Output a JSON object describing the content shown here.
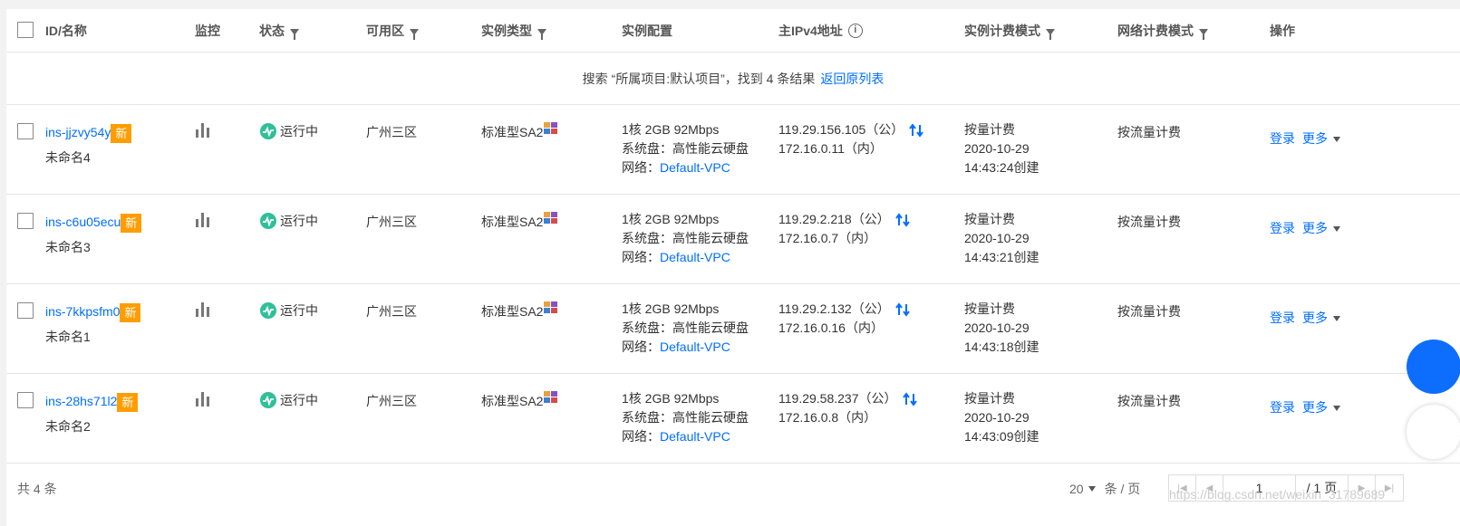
{
  "colors": {
    "accent": "#006eff",
    "badge": "#ff9d00",
    "status_running": "#2fc09a"
  },
  "header": {
    "id_name": "ID/名称",
    "monitor": "监控",
    "status": "状态",
    "zone": "可用区",
    "instance_type": "实例类型",
    "config": "实例配置",
    "ipv4": "主IPv4地址",
    "billing": "实例计费模式",
    "net_billing": "网络计费模式",
    "ops": "操作"
  },
  "notice": {
    "text": "搜索 “所属项目:默认项目”，找到 4 条结果",
    "link": "返回原列表"
  },
  "rows": [
    {
      "id": "ins-jjzvy54y",
      "badge": "新",
      "name": "未命名4",
      "status": "运行中",
      "zone": "广州三区",
      "type": "标准型SA2",
      "cfg1": "1核 2GB 92Mbps",
      "cfg2": "系统盘：高性能云硬盘",
      "cfg3_label": "网络：",
      "vpc": "Default-VPC",
      "ip_public": "119.29.156.105（公）",
      "ip_private": "172.16.0.11（内）",
      "billing": "按量计费",
      "date": "2020-10-29",
      "time": "14:43:24创建",
      "net_billing": "按流量计费",
      "login": "登录",
      "more": "更多"
    },
    {
      "id": "ins-c6u05ecu",
      "badge": "新",
      "name": "未命名3",
      "status": "运行中",
      "zone": "广州三区",
      "type": "标准型SA2",
      "cfg1": "1核 2GB 92Mbps",
      "cfg2": "系统盘：高性能云硬盘",
      "cfg3_label": "网络：",
      "vpc": "Default-VPC",
      "ip_public": "119.29.2.218（公）",
      "ip_private": "172.16.0.7（内）",
      "billing": "按量计费",
      "date": "2020-10-29",
      "time": "14:43:21创建",
      "net_billing": "按流量计费",
      "login": "登录",
      "more": "更多"
    },
    {
      "id": "ins-7kkpsfm0",
      "badge": "新",
      "name": "未命名1",
      "status": "运行中",
      "zone": "广州三区",
      "type": "标准型SA2",
      "cfg1": "1核 2GB 92Mbps",
      "cfg2": "系统盘：高性能云硬盘",
      "cfg3_label": "网络：",
      "vpc": "Default-VPC",
      "ip_public": "119.29.2.132（公）",
      "ip_private": "172.16.0.16（内）",
      "billing": "按量计费",
      "date": "2020-10-29",
      "time": "14:43:18创建",
      "net_billing": "按流量计费",
      "login": "登录",
      "more": "更多"
    },
    {
      "id": "ins-28hs71l2",
      "badge": "新",
      "name": "未命名2",
      "status": "运行中",
      "zone": "广州三区",
      "type": "标准型SA2",
      "cfg1": "1核 2GB 92Mbps",
      "cfg2": "系统盘：高性能云硬盘",
      "cfg3_label": "网络：",
      "vpc": "Default-VPC",
      "ip_public": "119.29.58.237（公）",
      "ip_private": "172.16.0.8（内）",
      "billing": "按量计费",
      "date": "2020-10-29",
      "time": "14:43:09创建",
      "net_billing": "按流量计费",
      "login": "登录",
      "more": "更多"
    }
  ],
  "footer": {
    "total": "共 4 条",
    "page_size": "20",
    "per_page": "条 / 页",
    "page_value": "1",
    "page_total": "/ 1 页",
    "watermark": "https://blog.csdn.net/weixin_31789689"
  }
}
